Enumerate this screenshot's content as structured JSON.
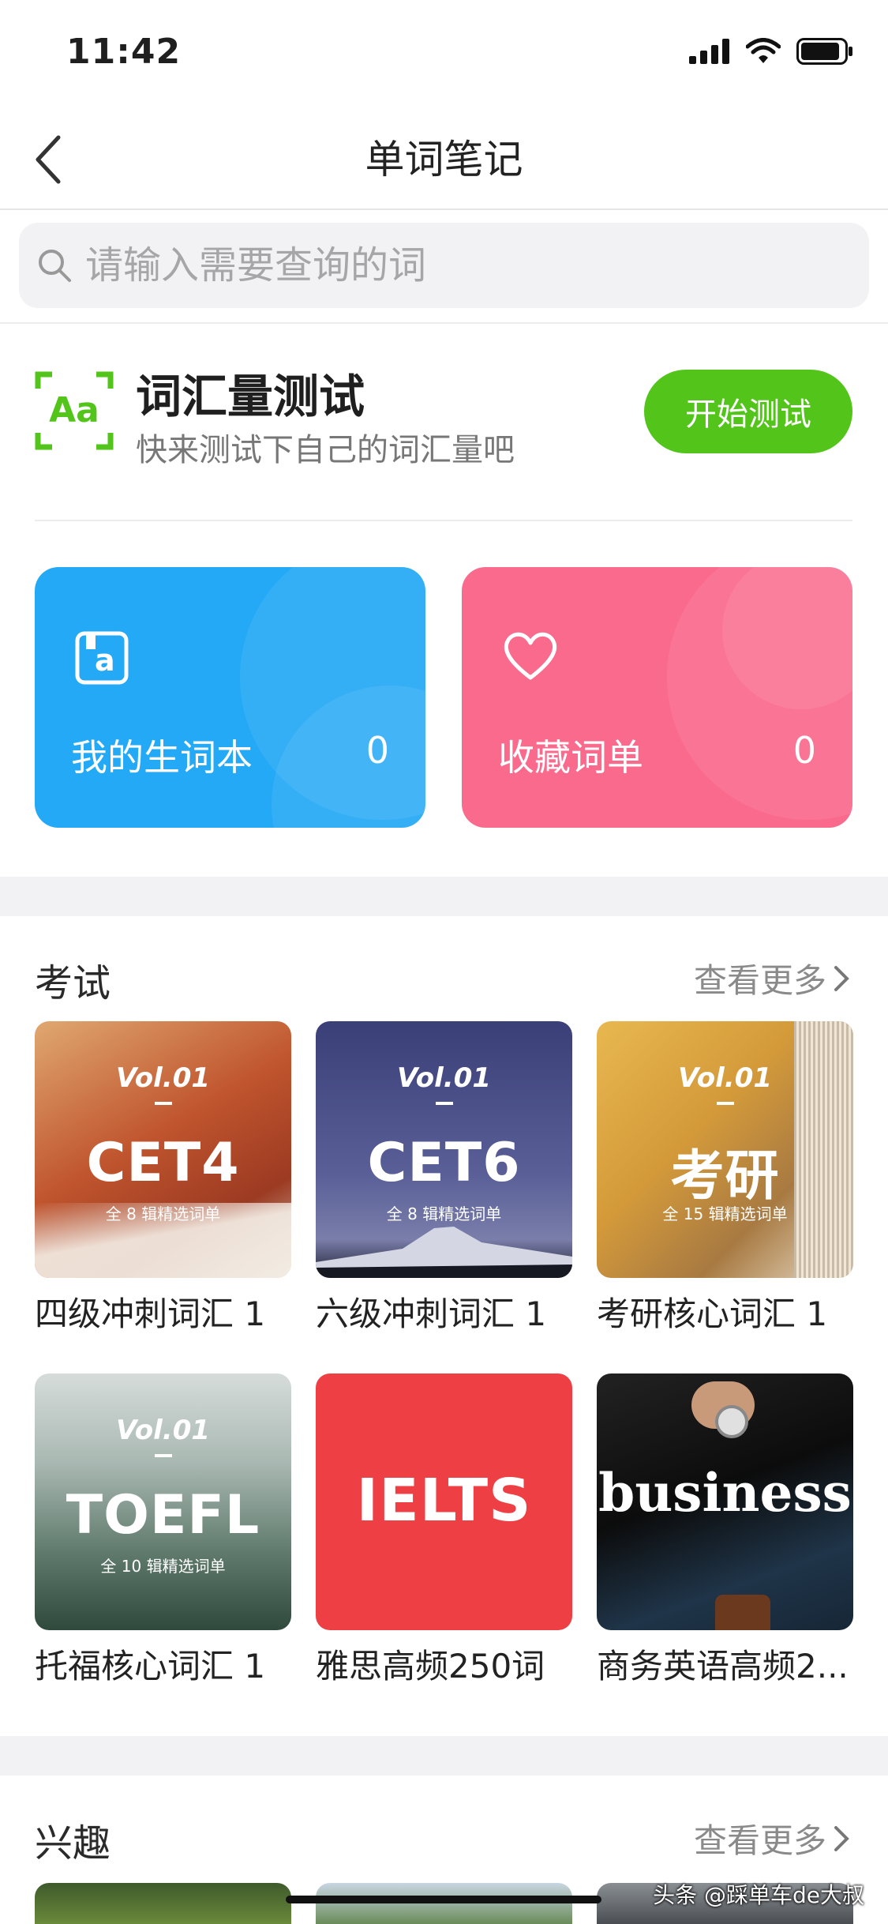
{
  "status_bar": {
    "time": "11:42"
  },
  "nav": {
    "title": "单词笔记"
  },
  "search": {
    "placeholder": "请输入需要查询的词"
  },
  "vocab_test": {
    "icon_text": "Aa",
    "title": "词汇量测试",
    "subtitle": "快来测试下自己的词汇量吧",
    "button": "开始测试"
  },
  "cards": [
    {
      "label": "我的生词本",
      "count": "0",
      "color": "#23a9f6",
      "icon": "wordbook-icon",
      "icon_text": "a"
    },
    {
      "label": "收藏词单",
      "count": "0",
      "color": "#fa6a8c",
      "icon": "heart-icon"
    }
  ],
  "exam": {
    "title": "考试",
    "more": "查看更多",
    "items": [
      {
        "vol": "Vol.01",
        "big": "CET4",
        "small": "全 8 辑精选词单",
        "caption": "四级冲刺词汇 1"
      },
      {
        "vol": "Vol.01",
        "big": "CET6",
        "small": "全 8 辑精选词单",
        "caption": "六级冲刺词汇 1"
      },
      {
        "vol": "Vol.01",
        "big": "考研",
        "small": "全 15 辑精选词单",
        "caption": "考研核心词汇 1"
      },
      {
        "vol": "Vol.01",
        "big": "TOEFL",
        "small": "全 10 辑精选词单",
        "caption": "托福核心词汇 1"
      },
      {
        "big": "IELTS",
        "caption": "雅思高频250词"
      },
      {
        "big": "business",
        "caption": "商务英语高频2..."
      }
    ]
  },
  "interest": {
    "title": "兴趣",
    "more": "查看更多"
  },
  "watermark": "头条 @踩单车de大叔"
}
